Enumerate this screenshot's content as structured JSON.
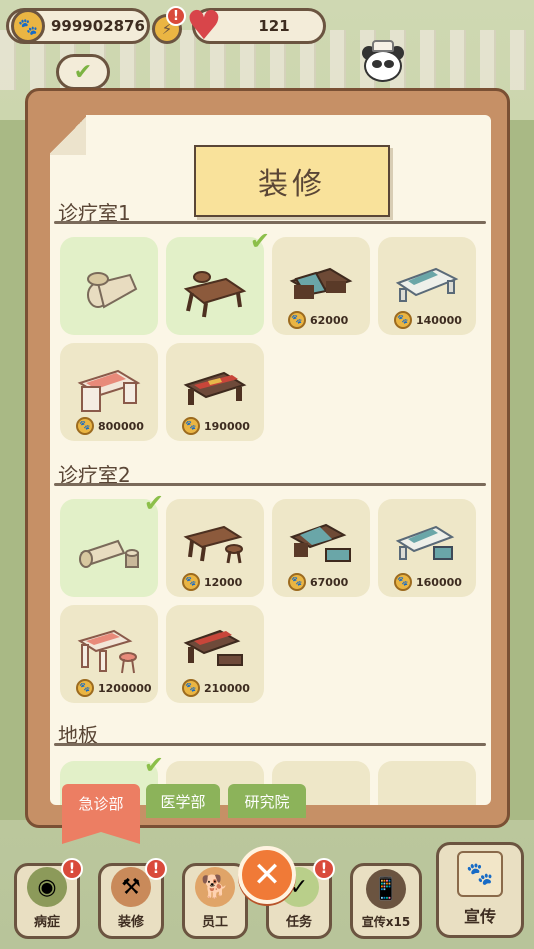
{
  "topbar": {
    "coins": "999902876",
    "hearts": "121"
  },
  "modal": {
    "title": "装修",
    "sections": [
      {
        "name": "诊疗室1",
        "items": [
          {
            "price": "",
            "owned": true,
            "equipped": false,
            "icon": "log-bench-icon"
          },
          {
            "price": "",
            "owned": true,
            "equipped": true,
            "icon": "wood-table-icon"
          },
          {
            "price": "62000",
            "owned": false,
            "equipped": false,
            "icon": "blue-cloth-table-icon"
          },
          {
            "price": "140000",
            "owned": false,
            "equipped": false,
            "icon": "striped-bench-icon"
          },
          {
            "price": "800000",
            "owned": false,
            "equipped": false,
            "icon": "pink-desk-icon"
          },
          {
            "price": "190000",
            "owned": false,
            "equipped": false,
            "icon": "red-runner-table-icon"
          }
        ]
      },
      {
        "name": "诊疗室2",
        "items": [
          {
            "price": "",
            "owned": true,
            "equipped": true,
            "icon": "log-stool-icon"
          },
          {
            "price": "12000",
            "owned": false,
            "equipped": false,
            "icon": "wood-table-stool-icon"
          },
          {
            "price": "67000",
            "owned": false,
            "equipped": false,
            "icon": "blue-cloth-table-set-icon"
          },
          {
            "price": "160000",
            "owned": false,
            "equipped": false,
            "icon": "striped-bench-stool-icon"
          },
          {
            "price": "1200000",
            "owned": false,
            "equipped": false,
            "icon": "pink-desk-stool-icon"
          },
          {
            "price": "210000",
            "owned": false,
            "equipped": false,
            "icon": "red-runner-table-set-icon"
          }
        ]
      },
      {
        "name": "地板",
        "items": []
      }
    ]
  },
  "tabs": [
    {
      "label": "急诊部",
      "active": true
    },
    {
      "label": "医学部",
      "active": false
    },
    {
      "label": "研究院",
      "active": false
    }
  ],
  "nav": {
    "illness": "病症",
    "decorate": "装修",
    "staff": "员工",
    "tasks": "任务",
    "promo_x": "宣传x15",
    "promo": "宣传"
  },
  "colors": {
    "accent_orange": "#f07a37",
    "owned_green": "#e2f0c8",
    "alert_red": "#d94a3b"
  }
}
